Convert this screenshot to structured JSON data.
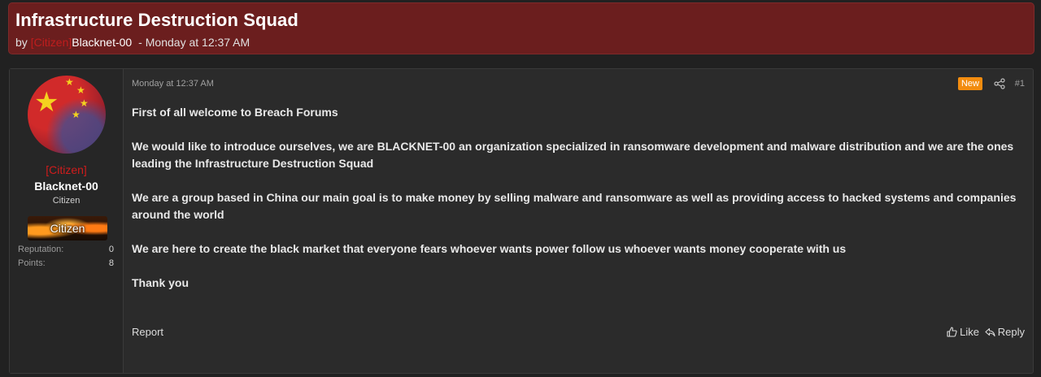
{
  "thread": {
    "title": "Infrastructure Destruction Squad",
    "by": "by",
    "author_rank": "[Citizen]",
    "author_name": "Blacknet-00",
    "separator": "-",
    "date": "Monday at 12:37 AM"
  },
  "post": {
    "date": "Monday at 12:37 AM",
    "new_badge": "New",
    "number": "#1",
    "paragraphs": [
      "First of all welcome to Breach Forums",
      "We would like to introduce ourselves, we are BLACKNET-00 an organization specialized in ransomware development and malware distribution and we are the ones leading the Infrastructure Destruction Squad",
      "We are a group based in China our main goal is to make money by selling malware and ransomware as well as providing access to hacked systems and companies around the world",
      "We are here to create the black market that everyone fears whoever wants power follow us whoever wants money cooperate with us",
      "Thank you"
    ],
    "report_label": "Report",
    "like_label": "Like",
    "reply_label": "Reply"
  },
  "user": {
    "rank": "[Citizen]",
    "name": "Blacknet-00",
    "title": "Citizen",
    "badge": "Citizen",
    "stats": [
      {
        "label": "Reputation:",
        "value": "0"
      },
      {
        "label": "Points:",
        "value": "8"
      }
    ]
  },
  "icons": {
    "share": "share-icon",
    "like": "thumbs-up-icon",
    "reply": "reply-icon",
    "avatar": "china-flag-avatar"
  },
  "colors": {
    "header_bg": "#6b1e1e",
    "rank_red": "#d01c1c",
    "new_badge": "#f28c0f",
    "page_bg": "#212121"
  }
}
